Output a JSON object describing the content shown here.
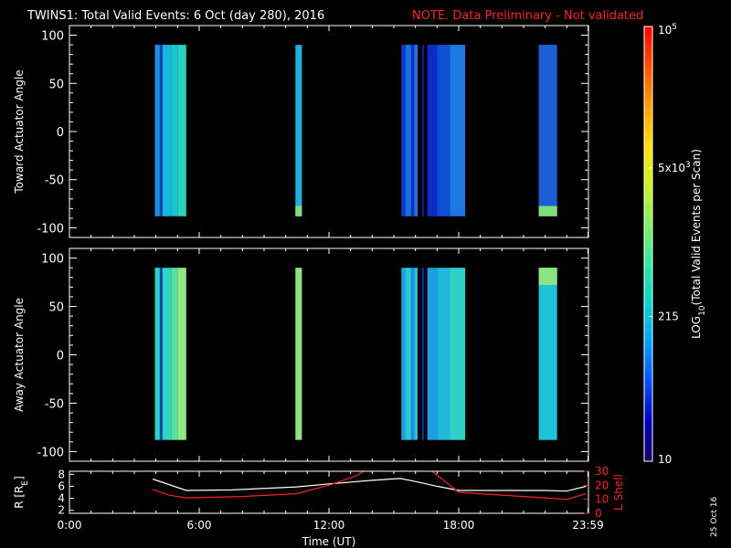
{
  "header": {
    "title": "TWINS1: Total Valid Events:  6 Oct (day 280), 2016",
    "note": "NOTE. Data Preliminary - Not validated",
    "note_color": "#ff2020"
  },
  "footer": {
    "date_stamp": "25 Oct 16"
  },
  "chart_data": [
    {
      "type": "heatmap",
      "panel": "toward",
      "ylabel": "Toward Actuator Angle",
      "ylim": [
        -110,
        110
      ],
      "xlim": [
        0,
        24
      ],
      "yticks": [
        -100,
        -50,
        0,
        50,
        100
      ],
      "angle_range": [
        -88,
        90
      ],
      "background": "#000000",
      "grid": false,
      "strips": [
        {
          "t0": 3.95,
          "t1": 4.18,
          "color": "#1f8fe6"
        },
        {
          "t0": 4.18,
          "t1": 4.3,
          "color": "#0a3fb5"
        },
        {
          "t0": 4.3,
          "t1": 4.7,
          "color": "#15b8dc"
        },
        {
          "t0": 4.7,
          "t1": 5.0,
          "color": "#1cc6cf"
        },
        {
          "t0": 5.0,
          "t1": 5.4,
          "color": "#2ad3c0"
        },
        {
          "t0": 10.45,
          "t1": 10.75,
          "color": "#18b3e0",
          "bottom_color": "#7fdc7a"
        },
        {
          "t0": 15.35,
          "t1": 15.55,
          "color": "#0d3fd0"
        },
        {
          "t0": 15.55,
          "t1": 15.8,
          "color": "#1a6ee0"
        },
        {
          "t0": 15.8,
          "t1": 15.95,
          "color": "#0b34c0"
        },
        {
          "t0": 15.95,
          "t1": 16.1,
          "color": "#1a7ae4"
        },
        {
          "t0": 16.1,
          "t1": 16.3,
          "color": "#000000"
        },
        {
          "t0": 16.3,
          "t1": 16.4,
          "color": "#0a1fa0"
        },
        {
          "t0": 16.4,
          "t1": 16.55,
          "color": "#000000"
        },
        {
          "t0": 16.55,
          "t1": 17.0,
          "color": "#0c2cc8"
        },
        {
          "t0": 17.0,
          "t1": 17.6,
          "color": "#1050d6"
        },
        {
          "t0": 17.6,
          "t1": 18.3,
          "color": "#1f78e2"
        },
        {
          "t0": 21.7,
          "t1": 22.55,
          "color": "#1a5fd8",
          "bottom_color": "#7fe07a"
        }
      ]
    },
    {
      "type": "heatmap",
      "panel": "away",
      "ylabel": "Away Actuator Angle",
      "ylim": [
        -110,
        110
      ],
      "xlim": [
        0,
        24
      ],
      "yticks": [
        -100,
        -50,
        0,
        50,
        100
      ],
      "angle_range": [
        -88,
        90
      ],
      "background": "#000000",
      "grid": false,
      "strips": [
        {
          "t0": 3.95,
          "t1": 4.18,
          "color": "#2ad4c6"
        },
        {
          "t0": 4.18,
          "t1": 4.3,
          "color": "#0a3fb5"
        },
        {
          "t0": 4.3,
          "t1": 4.7,
          "color": "#2bd7c0"
        },
        {
          "t0": 4.7,
          "t1": 5.0,
          "color": "#58e09c"
        },
        {
          "t0": 5.0,
          "t1": 5.4,
          "color": "#8fe883"
        },
        {
          "t0": 10.45,
          "t1": 10.75,
          "color": "#8ee27c"
        },
        {
          "t0": 15.35,
          "t1": 15.55,
          "color": "#1aa5e4"
        },
        {
          "t0": 15.55,
          "t1": 15.8,
          "color": "#2cc8d0"
        },
        {
          "t0": 15.8,
          "t1": 15.95,
          "color": "#1690e6"
        },
        {
          "t0": 15.95,
          "t1": 16.1,
          "color": "#28c0d4"
        },
        {
          "t0": 16.1,
          "t1": 16.3,
          "color": "#000000"
        },
        {
          "t0": 16.3,
          "t1": 16.4,
          "color": "#0a2ab4"
        },
        {
          "t0": 16.4,
          "t1": 16.55,
          "color": "#000000"
        },
        {
          "t0": 16.55,
          "t1": 17.0,
          "color": "#1c9ee2"
        },
        {
          "t0": 17.0,
          "t1": 17.6,
          "color": "#22b8dc"
        },
        {
          "t0": 17.6,
          "t1": 18.3,
          "color": "#2fd0c8"
        },
        {
          "t0": 21.7,
          "t1": 22.55,
          "color": "#1ec4d6",
          "top_color": "#8ae480"
        }
      ]
    },
    {
      "type": "line",
      "panel": "orbit",
      "xlabel": "Time (UT)",
      "xticks": [
        "0:00",
        "6:00",
        "12:00",
        "18:00",
        "23:59"
      ],
      "xtick_values": [
        0,
        6,
        12,
        18,
        23.98
      ],
      "xlim": [
        0,
        24
      ],
      "ylabel": "R [Rₑ]",
      "ylabel_parts": [
        "R [R",
        "E",
        "]"
      ],
      "ylim": [
        1.5,
        8.5
      ],
      "yticks": [
        2,
        4,
        6,
        8
      ],
      "y2label": "L Shell",
      "y2lim": [
        0,
        30
      ],
      "y2ticks": [
        0,
        10,
        20,
        30
      ],
      "y2_color": "#ff2020",
      "series": [
        {
          "axis": "left",
          "color": "#ffffff",
          "x": [
            3.85,
            4.6,
            5.4,
            7.5,
            10.5,
            12.0,
            14.0,
            15.3,
            16.0,
            17.0,
            18.0,
            20.0,
            22.0,
            23.0,
            23.9
          ],
          "y": [
            7.2,
            6.3,
            5.3,
            5.4,
            5.9,
            6.4,
            7.0,
            7.3,
            6.8,
            6.0,
            5.3,
            5.3,
            5.3,
            5.2,
            6.0
          ]
        },
        {
          "axis": "right",
          "color": "#ff2020",
          "x": [
            3.85,
            4.6,
            5.4,
            8.0,
            10.5,
            12.0,
            13.3,
            14.0,
            16.6,
            18.0,
            20.0,
            22.0,
            23.0,
            23.9
          ],
          "y": [
            17,
            13,
            11,
            12,
            14,
            20,
            27,
            34,
            32,
            15,
            13,
            11,
            10,
            14
          ]
        }
      ]
    },
    {
      "type": "colorbar",
      "label": "LOG₁₀(Total Valid Events per Scan)",
      "label_parts": [
        "LOG",
        "10",
        "(Total Valid  Events per Scan)"
      ],
      "scale": "log",
      "range": [
        10,
        100000
      ],
      "tick_labels": [
        {
          "value": 10,
          "text": "10"
        },
        {
          "value": 215,
          "text": "215"
        },
        {
          "value": 5000,
          "text": "5x10",
          "sup": "3"
        },
        {
          "value": 100000,
          "text": "10",
          "sup": "5"
        }
      ],
      "colors": [
        "#1a0068",
        "#0000c8",
        "#0050ff",
        "#00a0ff",
        "#00d8d0",
        "#30e8a0",
        "#80f060",
        "#d0f020",
        "#ffe000",
        "#ffa000",
        "#ff5000",
        "#ff0000"
      ]
    }
  ]
}
